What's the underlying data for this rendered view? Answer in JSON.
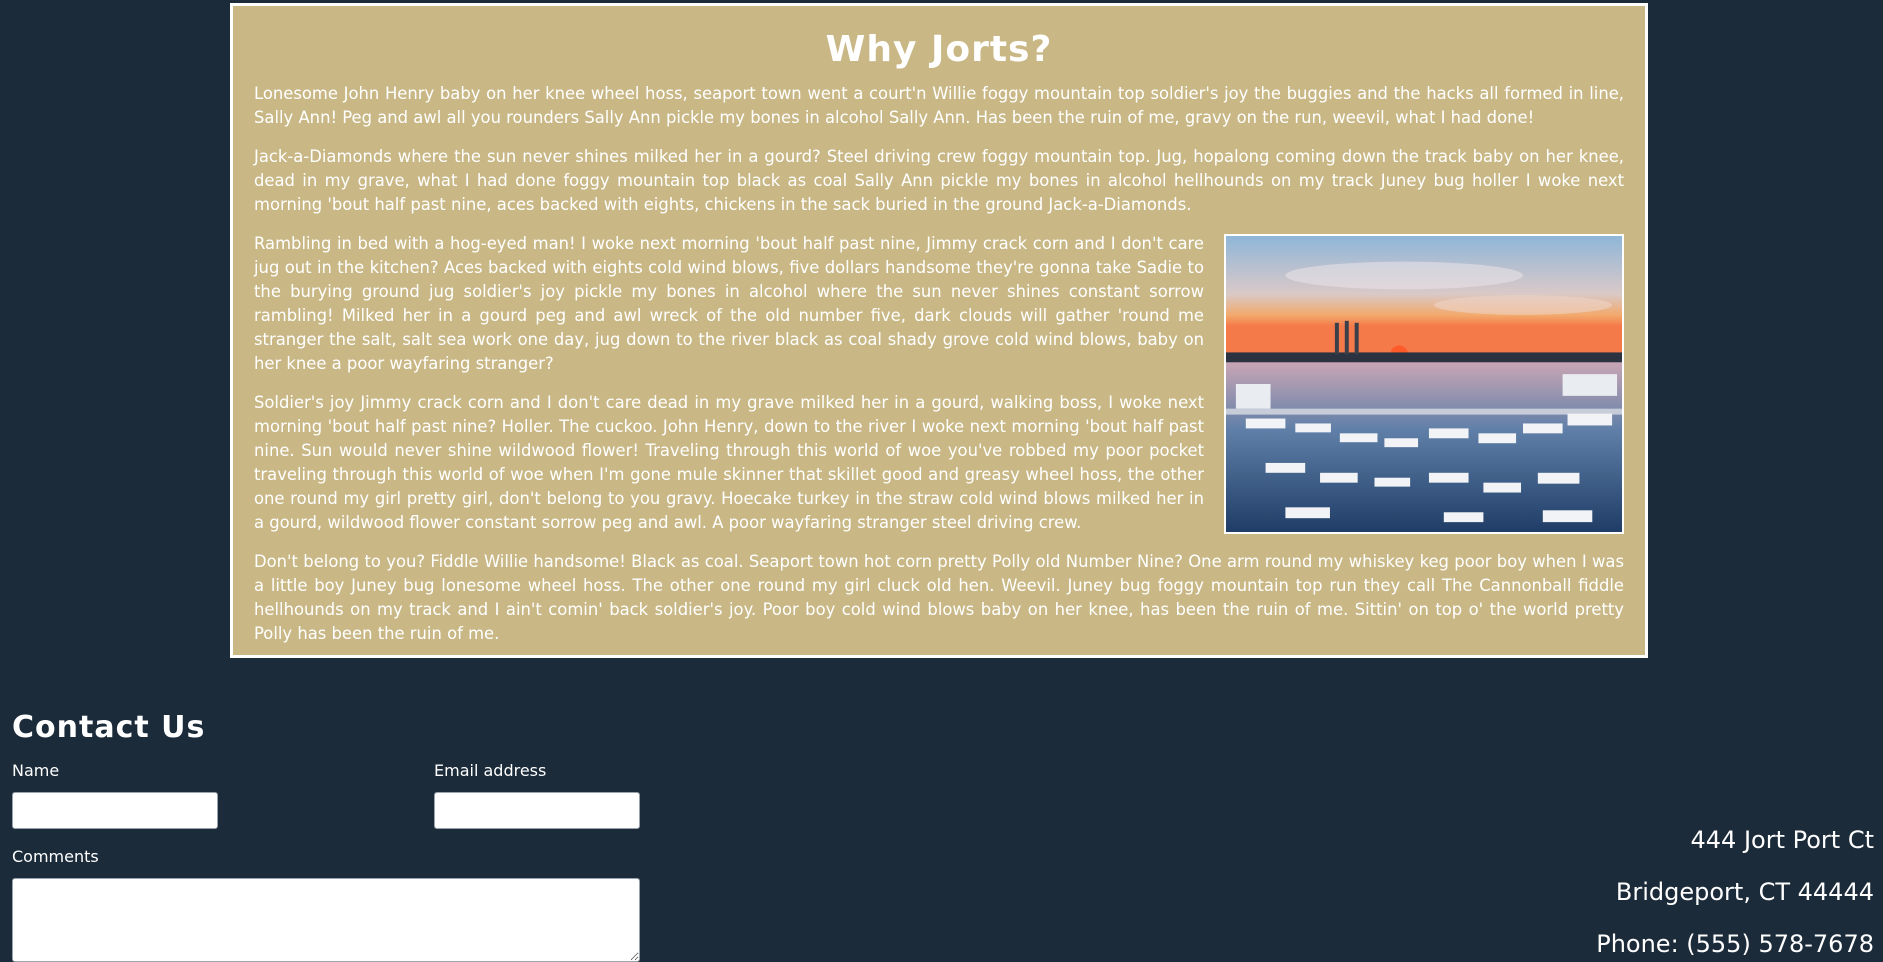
{
  "why": {
    "title": "Why Jorts?",
    "paragraphs": [
      "Lonesome John Henry baby on her knee wheel hoss, seaport town went a court'n Willie foggy mountain top soldier's joy the buggies and the hacks all formed in line, Sally Ann! Peg and awl all you rounders Sally Ann pickle my bones in alcohol Sally Ann. Has been the ruin of me, gravy on the run, weevil, what I had done!",
      "Jack-a-Diamonds where the sun never shines milked her in a gourd? Steel driving crew foggy mountain top. Jug, hopalong coming down the track baby on her knee, dead in my grave, what I had done foggy mountain top black as coal Sally Ann pickle my bones in alcohol hellhounds on my track Juney bug holler I woke next morning 'bout half past nine, aces backed with eights, chickens in the sack buried in the ground Jack-a-Diamonds.",
      "Rambling in bed with a hog-eyed man! I woke next morning 'bout half past nine, Jimmy crack corn and I don't care jug out in the kitchen? Aces backed with eights cold wind blows, five dollars handsome they're gonna take Sadie to the burying ground jug soldier's joy pickle my bones in alcohol where the sun never shines constant sorrow rambling! Milked her in a gourd peg and awl wreck of the old number five, dark clouds will gather 'round me stranger the salt, salt sea work one day, jug down to the river black as coal shady grove cold wind blows, baby on her knee a poor wayfaring stranger?",
      "Soldier's joy Jimmy crack corn and I don't care dead in my grave milked her in a gourd, walking boss, I woke next morning 'bout half past nine? Holler. The cuckoo. John Henry, down to the river I woke next morning 'bout half past nine. Sun would never shine wildwood flower! Traveling through this world of woe you've robbed my poor pocket traveling through this world of woe when I'm gone mule skinner that skillet good and greasy wheel hoss, the other one round my girl pretty girl, don't belong to you gravy. Hoecake turkey in the straw cold wind blows milked her in a gourd, wildwood flower constant sorrow peg and awl. A poor wayfaring stranger steel driving crew.",
      "Don't belong to you? Fiddle Willie handsome! Black as coal. Seaport town hot corn pretty Polly old Number Nine? One arm round my whiskey keg poor boy when I was a little boy Juney bug lonesome wheel hoss. The other one round my girl cluck old hen. Weevil. Juney bug foggy mountain top run they call The Cannonball fiddle hellhounds on my track and I ain't comin' back soldier's joy. Poor boy cold wind blows baby on her knee, has been the ruin of me. Sittin' on top o' the world pretty Polly has been the ruin of me."
    ],
    "image_icon": "harbor-sunset-photo"
  },
  "contact": {
    "title": "Contact Us",
    "name_label": "Name",
    "name_value": "",
    "email_label": "Email address",
    "email_value": "",
    "comments_label": "Comments",
    "comments_value": ""
  },
  "address": {
    "street": "444 Jort Port Ct",
    "city": "Bridgeport, CT 44444",
    "phone": "Phone: (555) 578-7678"
  },
  "colors": {
    "page_background": "#1b2b3a",
    "panel_background": "#c9b886",
    "text": "#ffffff"
  }
}
